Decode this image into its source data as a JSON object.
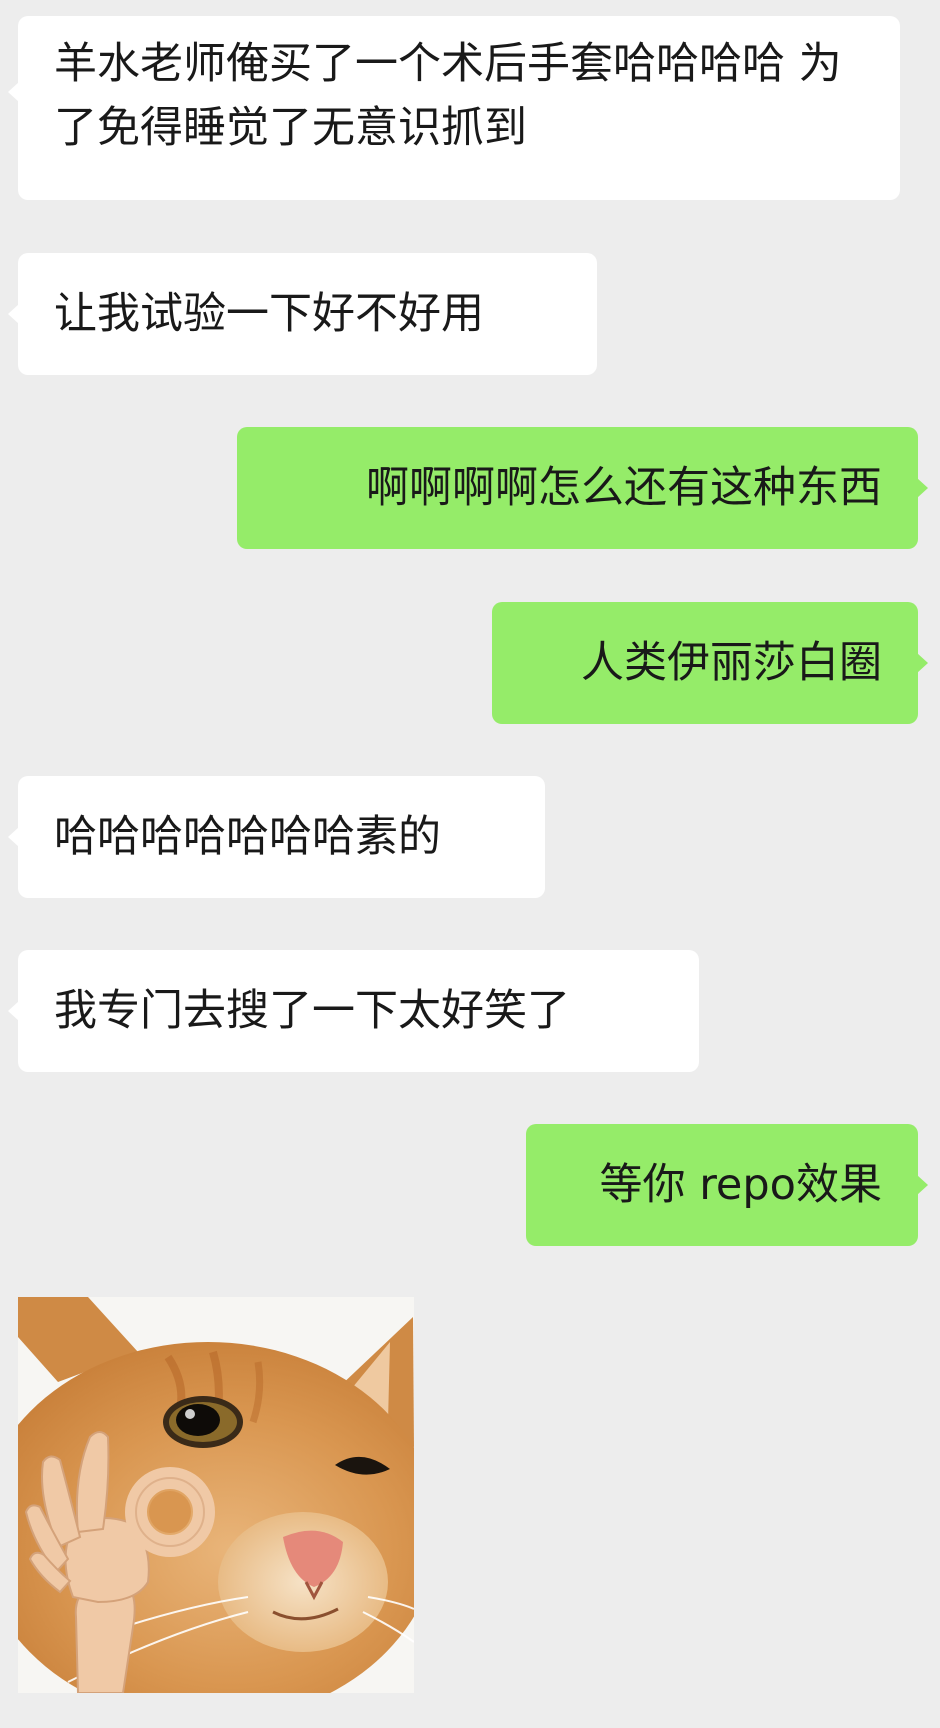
{
  "messages": [
    {
      "side": "incoming",
      "text": "羊水老师俺买了一个术后手套哈哈哈哈 为了免得睡觉了无意识抓到"
    },
    {
      "side": "incoming",
      "text": "让我试验一下好不好用"
    },
    {
      "side": "outgoing",
      "text": "啊啊啊啊怎么还有这种东西"
    },
    {
      "side": "outgoing",
      "text": "人类伊丽莎白圈"
    },
    {
      "side": "incoming",
      "text": "哈哈哈哈哈哈哈素的"
    },
    {
      "side": "incoming",
      "text": "我专门去搜了一下太好笑了"
    },
    {
      "side": "outgoing",
      "text": "等你 repo效果"
    }
  ],
  "sticker": {
    "side": "incoming",
    "icon": "cat-ok-hand-sticker"
  },
  "colors": {
    "background": "#ededed",
    "incoming_bubble": "#ffffff",
    "outgoing_bubble": "#95ec69",
    "text": "#191919"
  }
}
